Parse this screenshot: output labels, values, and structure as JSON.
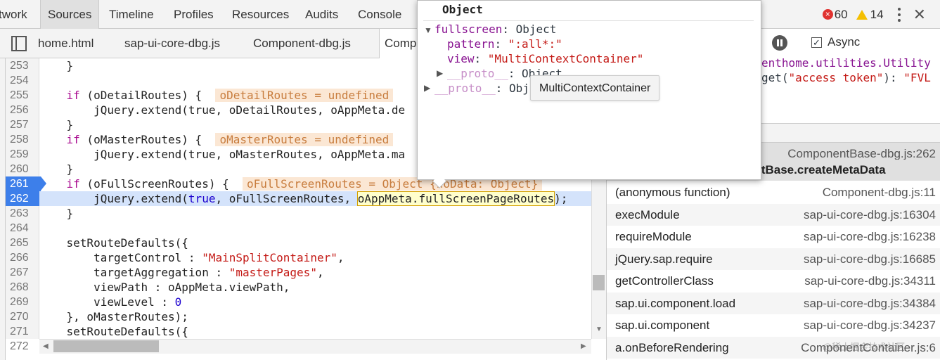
{
  "toptabs": [
    "twork",
    "Sources",
    "Timeline",
    "Profiles",
    "Resources",
    "Audits",
    "Console"
  ],
  "errors": "60",
  "warnings": "14",
  "filetabs": [
    "home.html",
    "sap-ui-core-dbg.js",
    "Component-dbg.js",
    "Comp"
  ],
  "code": {
    "lines": [
      "253",
      "254",
      "255",
      "256",
      "257",
      "258",
      "259",
      "260",
      "261",
      "262",
      "263",
      "264",
      "265",
      "266",
      "267",
      "268",
      "269",
      "270",
      "271",
      "272"
    ],
    "breakpoints": [
      "261",
      "262"
    ],
    "current_line": "262",
    "l253": "    }",
    "l255a": "    ",
    "l255kw": "if",
    "l255b": " (oDetailRoutes) {  ",
    "l255inl": "oDetailRoutes = undefined",
    "l256": "        jQuery.extend(true, oDetailRoutes, oAppMeta.de",
    "l257": "    }",
    "l258a": "    ",
    "l258kw": "if",
    "l258b": " (oMasterRoutes) {  ",
    "l258inl": "oMasterRoutes = undefined",
    "l259": "        jQuery.extend(true, oMasterRoutes, oAppMeta.ma",
    "l260": "    }",
    "l261a": "    ",
    "l261kw": "if",
    "l261b": " (oFullScreenRoutes) {  ",
    "l261inl": "oFullScreenRoutes = Object {noData: Object}",
    "l262a": "        jQuery.extend(",
    "l262kw": "true",
    "l262b": ", oFullScreenRoutes, ",
    "l262hl": "oAppMeta.fullScreenPageRoutes",
    "l262c": ");",
    "l263": "    }",
    "l265": "    setRouteDefaults({",
    "l266a": "        targetControl : ",
    "l266s": "\"MainSplitContainer\"",
    "l266b": ",",
    "l267a": "        targetAggregation : ",
    "l267s": "\"masterPages\"",
    "l267b": ",",
    "l268": "        viewPath : oAppMeta.viewPath,",
    "l269a": "        viewLevel : ",
    "l269n": "0",
    "l270": "    }, oMasterRoutes);",
    "l271": "    setRouteDefaults({"
  },
  "popover": {
    "title": "Object",
    "l1k": "fullscreen",
    "l1v": ": Object",
    "l2k": "pattern",
    "l2c": ": ",
    "l2v": "\":all*:\"",
    "l3k": "view",
    "l3c": ": ",
    "l3v": "\"MultiContextContainer\"",
    "l4k": "__proto__",
    "l4v": ": Object",
    "l5k": "__proto__",
    "l5v": ": Obj"
  },
  "tooltip": "MultiContextContainer",
  "async_label": "Async",
  "watch": {
    "w1": "enthome.utilities.Utility",
    "w2a": "get(",
    "w2s": "\"access token\"",
    "w2b": "): ",
    "w2v": "\"FVL"
  },
  "callstack": [
    {
      "fn": "",
      "loc": "ComponentBase-dbg.js:262"
    },
    {
      "fn": "entBase.createMetaData",
      "loc": ""
    },
    {
      "fn": "(anonymous function)",
      "loc": "Component-dbg.js:11"
    },
    {
      "fn": "execModule",
      "loc": "sap-ui-core-dbg.js:16304"
    },
    {
      "fn": "requireModule",
      "loc": "sap-ui-core-dbg.js:16238"
    },
    {
      "fn": "jQuery.sap.require",
      "loc": "sap-ui-core-dbg.js:16685"
    },
    {
      "fn": "getControllerClass",
      "loc": "sap-ui-core-dbg.js:34311"
    },
    {
      "fn": "sap.ui.component.load",
      "loc": "sap-ui-core-dbg.js:34384"
    },
    {
      "fn": "sap.ui.component",
      "loc": "sap-ui-core-dbg.js:34237"
    },
    {
      "fn": "a.onBeforeRendering",
      "loc": "ComponentContainer.js:6"
    }
  ],
  "watermark": "@稀土掘金技术社区",
  "colors": {
    "breakpoint": "#3d7fea",
    "exec_line": "#d4e3fb",
    "keyword": "#aa0d91",
    "string": "#c41a16"
  }
}
